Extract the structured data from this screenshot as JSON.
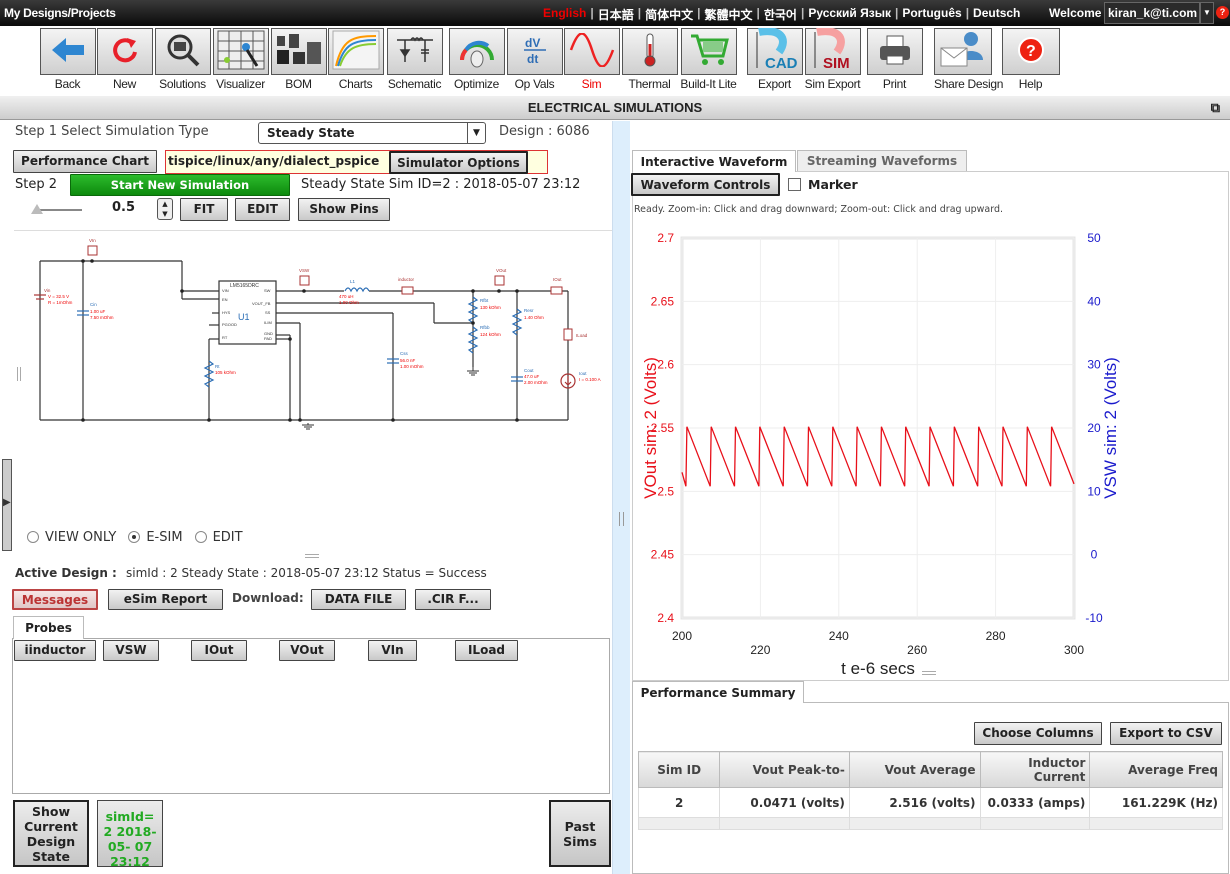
{
  "topbar": {
    "brand": "My Designs/Projects",
    "languages": [
      "English",
      "日本語",
      "简体中文",
      "繁體中文",
      "한국어",
      "Русский Язык",
      "Português",
      "Deutsch"
    ],
    "active_language": "English",
    "welcome_label": "Welcome",
    "user": "kiran_k@ti.com"
  },
  "toolbar": [
    {
      "label": "Back",
      "icon": "back-arrow-icon"
    },
    {
      "label": "New",
      "icon": "refresh-icon"
    },
    {
      "label": "Solutions",
      "icon": "magnifier-chip-icon"
    },
    {
      "label": "Visualizer",
      "icon": "visualizer-grid-icon"
    },
    {
      "label": "BOM",
      "icon": "components-icon"
    },
    {
      "label": "Charts",
      "icon": "chart-curves-icon"
    },
    {
      "label": "Schematic",
      "icon": "schematic-icon"
    },
    {
      "label": "Optimize",
      "icon": "dial-icon"
    },
    {
      "label": "Op Vals",
      "icon": "dv-dt-icon"
    },
    {
      "label": "Sim",
      "icon": "sine-wave-icon",
      "active": true
    },
    {
      "label": "Thermal",
      "icon": "thermometer-icon"
    },
    {
      "label": "Build-It Lite",
      "icon": "cart-icon"
    },
    {
      "label": "Export",
      "icon": "cad-export-icon"
    },
    {
      "label": "Sim Export",
      "icon": "sim-export-icon"
    },
    {
      "label": "Print",
      "icon": "printer-icon"
    },
    {
      "label": "Share Design",
      "icon": "share-envelope-icon"
    },
    {
      "label": "Help",
      "icon": "help-icon"
    }
  ],
  "panel_title": "ELECTRICAL SIMULATIONS",
  "left": {
    "step1_label": "Step 1 Select Simulation Type",
    "sim_type": "Steady State",
    "design_label": "Design : 6086",
    "performance_chart_btn": "Performance Chart",
    "sim_path": "tispice/linux/any/dialect_pspice",
    "simulator_options_btn": "Simulator Options",
    "step2_label": "Step 2",
    "start_sim_btn": "Start New Simulation",
    "sim_info": "Steady State Sim ID=2 : 2018-05-07 23:12",
    "zoom_value": "0.5",
    "fit_btn": "FIT",
    "edit_btn": "EDIT",
    "show_pins_btn": "Show Pins",
    "modes": [
      {
        "label": "VIEW ONLY",
        "selected": false
      },
      {
        "label": "E-SIM",
        "selected": true
      },
      {
        "label": "EDIT",
        "selected": false
      }
    ],
    "active_design_label": "Active Design :",
    "active_design_value": "simId : 2 Steady State : 2018-05-07 23:12 Status = Success",
    "messages_btn": "Messages",
    "esim_report_btn": "eSim Report",
    "download_label": "Download:",
    "data_file_btn": "DATA FILE",
    "cir_file_btn": ".CIR F...",
    "probes_tab": "Probes",
    "probes": [
      "iinductor",
      "VSW",
      "IOut",
      "VOut",
      "VIn",
      "ILoad"
    ],
    "show_current_btn": "Show Current Design State",
    "sim_card": "simId= 2 2018-05- 07 23:12",
    "past_sims_btn": "Past Sims"
  },
  "schematic": {
    "ic_part": "LM5165DRC",
    "ic_ref": "U1",
    "ic_pins_left": [
      "VIN",
      "EN",
      "HYS",
      "PGOOD",
      "RT"
    ],
    "ic_pins_right": [
      "SW",
      "VOUT_FB",
      "SS",
      "ILIM",
      "GND",
      "PAD"
    ],
    "probes": [
      "VIn",
      "VSW",
      "VOut",
      "inductor",
      "IOut",
      "ILoad"
    ],
    "components": [
      {
        "ref": "Vin",
        "value": "V = 32.5 V",
        "value2": "R = 1mOhm"
      },
      {
        "ref": "Cin",
        "value": "1.00 uF",
        "value2": "7.50 mOhm"
      },
      {
        "ref": "Rt",
        "value": "105 kOhm"
      },
      {
        "ref": "L1",
        "value": "470 uH",
        "value2": "1.00 Ohm"
      },
      {
        "ref": "Css",
        "value": "56.0 nF",
        "value2": "1.00 mOhm"
      },
      {
        "ref": "Rfbt",
        "value": "130 kOhm"
      },
      {
        "ref": "Rfbb",
        "value": "124 kOhm"
      },
      {
        "ref": "Resr",
        "value": "1.40 Ohm"
      },
      {
        "ref": "Cout",
        "value": "47.0 uF",
        "value2": "2.00 mOhm"
      },
      {
        "ref": "Iout",
        "value": "I = 0.100 A"
      }
    ]
  },
  "right": {
    "tabs": [
      {
        "label": "Interactive Waveform",
        "active": true
      },
      {
        "label": "Streaming Waveforms",
        "active": false
      }
    ],
    "waveform_controls_btn": "Waveform Controls",
    "marker_label": "Marker",
    "marker_checked": false,
    "status": "Ready.  Zoom-in: Click and drag downward; Zoom-out: Click and drag upward.",
    "perf_tab": "Performance Summary",
    "choose_columns_btn": "Choose Columns",
    "export_csv_btn": "Export to CSV",
    "perf_columns": [
      "Sim ID",
      "Vout Peak-to-",
      "Vout Average",
      "Inductor Current",
      "Average Freq"
    ],
    "perf_rows": [
      [
        "2",
        "0.0471 (volts)",
        "2.516 (volts)",
        "0.0333 (amps)",
        "161.229K (Hz)"
      ]
    ]
  },
  "chart_data": {
    "type": "line",
    "title": "",
    "xlabel": "t e-6 secs",
    "ylabel": "VOut sim:  2 (Volts)",
    "y2label": "VSW sim:  2 (Volts)",
    "xlim": [
      200,
      300
    ],
    "ylim": [
      2.4,
      2.7
    ],
    "y2lim": [
      -10,
      50
    ],
    "x_ticks": [
      "200",
      "220",
      "240",
      "260",
      "280",
      "300"
    ],
    "y_ticks": [
      "2.4",
      "2.45",
      "2.5",
      "2.55",
      "2.6",
      "2.65",
      "2.7"
    ],
    "y2_ticks": [
      "-10",
      "0",
      "10",
      "20",
      "30",
      "40",
      "50"
    ],
    "grid": true,
    "series": [
      {
        "name": "VOut sim: 2",
        "color": "#e8101a",
        "axis": "left",
        "shape": "sawtooth",
        "frequency_khz": 161.229,
        "peak": 2.551,
        "trough": 2.504,
        "first_trough_us": 201.0,
        "start_value": 2.515,
        "end_value": 2.508
      }
    ],
    "left_axis_color": "#e8101a",
    "right_axis_color": "#1a1acc"
  }
}
